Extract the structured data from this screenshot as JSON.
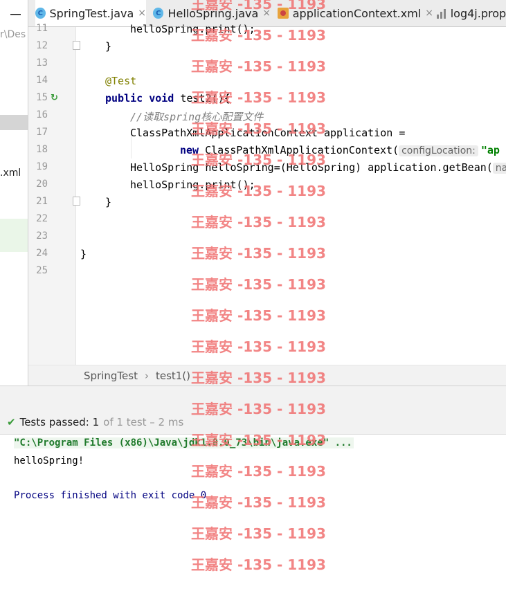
{
  "project_panel": {
    "path_fragment": "r\\Des",
    "xml_fragment": ".xml"
  },
  "tabs": [
    {
      "label": "SpringTest.java",
      "active": true
    },
    {
      "label": "HelloSpring.java",
      "active": false
    },
    {
      "label": "applicationContext.xml",
      "active": false
    },
    {
      "label": "log4j.prope",
      "active": false
    }
  ],
  "editor": {
    "line_numbers": [
      "11",
      "12",
      "13",
      "14",
      "15",
      "16",
      "17",
      "18",
      "19",
      "20",
      "21",
      "22",
      "23",
      "24",
      "25"
    ],
    "lines": {
      "l11": "helloSpring.print();",
      "l12": "}",
      "l14": "@Test",
      "l15_kw1": "public",
      "l15_kw2": "void",
      "l15_rest": " test2(){",
      "l16": "//读取spring核心配置文件",
      "l17": "ClassPathXmlApplicationContext application =",
      "l18_kw": "new",
      "l18_rest": " ClassPathXmlApplicationContext(",
      "l18_hint": "configLocation:",
      "l18_str": "\"ap",
      "l19": "HelloSpring helloSpring=(HelloSpring) application.getBean(",
      "l19_hint": "na",
      "l20": "helloSpring.print();",
      "l21": "}",
      "l24": "}"
    }
  },
  "breadcrumb": {
    "class_name": "SpringTest",
    "method_name": "test1()"
  },
  "test_status": {
    "passed_label": "Tests passed: 1",
    "detail": "of 1 test – 2 ms"
  },
  "console": {
    "command": "\"C:\\Program Files (x86)\\Java\\jdk1.8.0_73\\bin\\java.exe\" ...",
    "output": "helloSpring!",
    "finished": "Process finished with exit code 0"
  },
  "watermark": "王嘉安 -135 - 1193"
}
